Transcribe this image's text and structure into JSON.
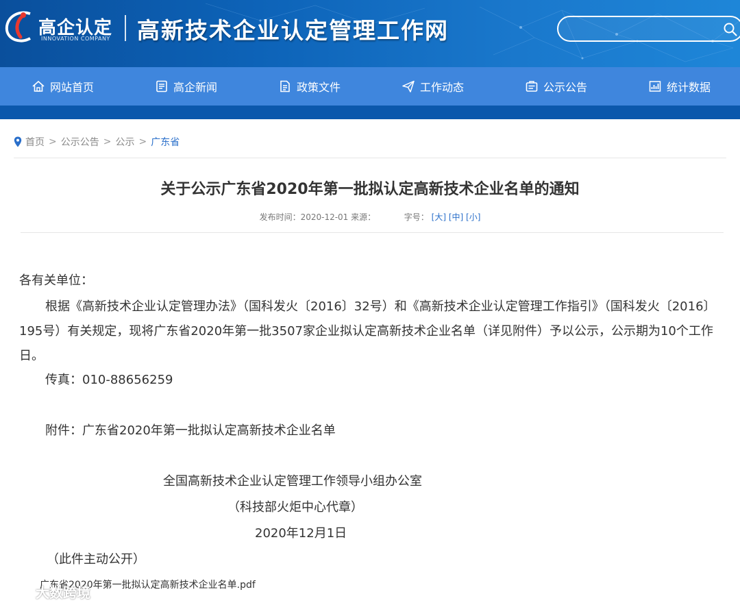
{
  "header": {
    "logo_text": "高企认定",
    "logo_subtext": "INNOVATION COMPANY",
    "site_title": "高新技术企业认定管理工作网",
    "search_placeholder": ""
  },
  "nav": {
    "items": [
      {
        "label": "网站首页",
        "icon": "home-icon"
      },
      {
        "label": "高企新闻",
        "icon": "news-icon"
      },
      {
        "label": "政策文件",
        "icon": "document-icon"
      },
      {
        "label": "工作动态",
        "icon": "paper-plane-icon"
      },
      {
        "label": "公示公告",
        "icon": "announcement-icon"
      },
      {
        "label": "统计数据",
        "icon": "chart-icon"
      }
    ]
  },
  "breadcrumb": {
    "items": [
      "首页",
      "公示公告",
      "公示"
    ],
    "separator": ">",
    "current": "广东省"
  },
  "article": {
    "title": "关于公示广东省2020年第一批拟认定高新技术企业名单的通知",
    "meta": {
      "publish_label": "发布时间：2020-12-01 来源：",
      "font_size_label": "字号：",
      "font_large": "[大]",
      "font_medium": "[中]",
      "font_small": "[小]"
    },
    "salutation": "各有关单位：",
    "paragraph": "根据《高新技术企业认定管理办法》（国科发火〔2016〕32号）和《高新技术企业认定管理工作指引》（国科发火〔2016〕195号）有关规定，现将广东省2020年第一批3507家企业拟认定高新技术企业名单（详见附件）予以公示，公示期为10个工作日。",
    "fax": "传真：010-88656259",
    "attachment_line": "附件：广东省2020年第一批拟认定高新技术企业名单",
    "signature_org": "全国高新技术企业认定管理工作领导小组办公室",
    "signature_note": "（科技部火炬中心代章）",
    "signature_date": "2020年12月1日",
    "public_note": "（此件主动公开）",
    "attachment_file": "广东省2020年第一批拟认定高新技术企业名单.pdf"
  },
  "watermark": {
    "text": "大数跨境",
    "icon": "watermark-logo-icon"
  },
  "colors": {
    "banner": "#0d63b8",
    "nav": "#3f86dd",
    "nav_strip": "#0b58ac",
    "link": "#2a6fca"
  }
}
